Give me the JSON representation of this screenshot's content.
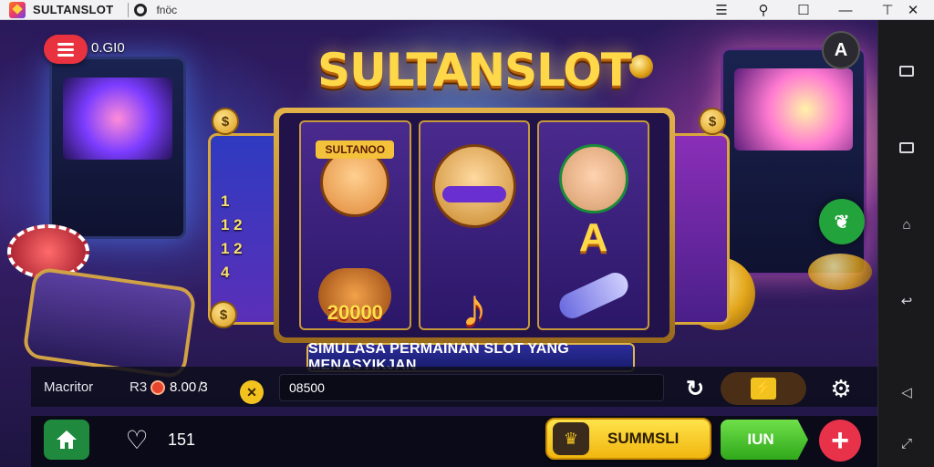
{
  "titlebar": {
    "app_name": "SULTANSLOT",
    "subtitle": "fnöc",
    "controls": [
      "settings-lines-icon",
      "search-icon",
      "maximize-icon",
      "minimize-icon",
      "close-icon"
    ]
  },
  "game": {
    "top_balance": "0.GI0",
    "corner_button": "A",
    "brand_title": "SULTANSLOT",
    "reel1_tag": "SULTANOO",
    "reel1_prize": "20000",
    "reel3_symbol": "A",
    "paylines": [
      "1",
      "1 2",
      "1 2",
      "4"
    ],
    "banner_text": "SIMULASA PERMAINAN SLOT YANG MENASYIKJAN",
    "coin_symbol": "$",
    "accent_colors": {
      "gold": "#ffd84a",
      "red": "#e8323f",
      "green": "#22a33c",
      "purple": "#3a1f6e"
    }
  },
  "info_bar": {
    "machine_label": "Macritor",
    "bet_label": "R3",
    "bet_value": "8.00 ̸3",
    "x_button": "✕",
    "win_field_value": "08500",
    "auto_glyph": "⚡"
  },
  "action_bar": {
    "lives": "151",
    "simulate_label": "SUMMSLI",
    "join_label": "IUN",
    "plus_label": "+"
  },
  "navrail": {
    "items": [
      "overview-icon",
      "recents-icon",
      "home-icon",
      "back-icon",
      "back-icon",
      "rotate-icon"
    ]
  }
}
